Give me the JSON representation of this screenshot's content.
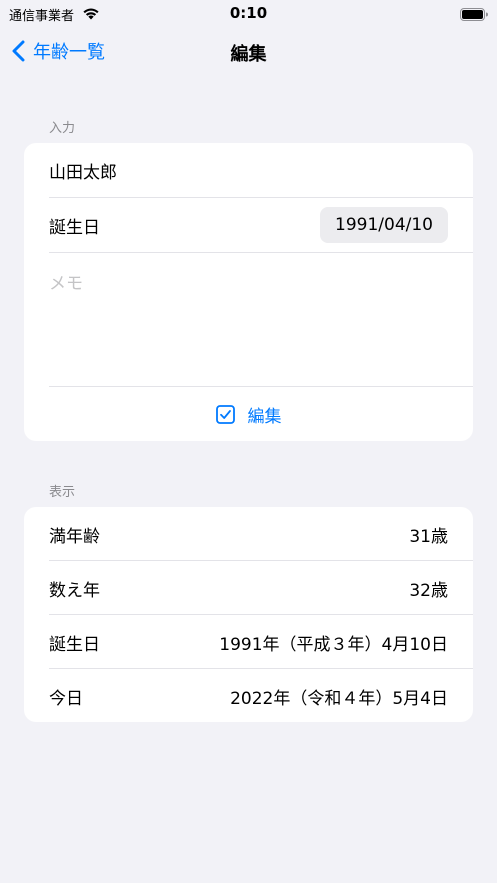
{
  "status_bar": {
    "carrier": "通信事業者",
    "time": "0:10"
  },
  "nav": {
    "back_label": "年齢一覧",
    "title": "編集"
  },
  "input_section": {
    "header": "入力",
    "name_value": "山田太郎",
    "birthday_label": "誕生日",
    "birthday_value": "1991/04/10",
    "memo_placeholder": "メモ",
    "edit_button_label": "編集"
  },
  "display_section": {
    "header": "表示",
    "rows": [
      {
        "label": "満年齢",
        "value": "31歳"
      },
      {
        "label": "数え年",
        "value": "32歳"
      },
      {
        "label": "誕生日",
        "value": "1991年（平成３年）4月10日"
      },
      {
        "label": "今日",
        "value": "2022年（令和４年）5月4日"
      }
    ]
  },
  "colors": {
    "accent": "#007aff",
    "background": "#f2f2f7",
    "secondary_text": "#8a8a8e"
  }
}
